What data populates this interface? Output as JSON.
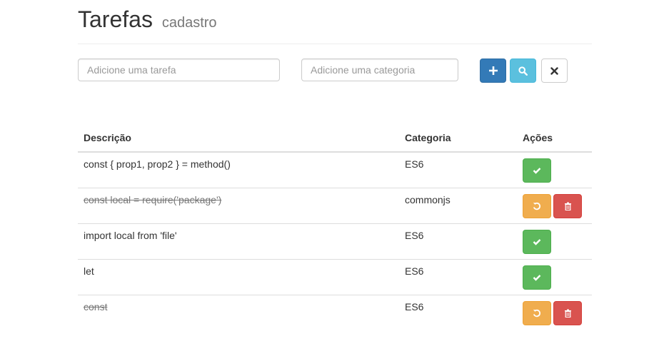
{
  "header": {
    "title": "Tarefas",
    "subtitle": "cadastro"
  },
  "form": {
    "task_placeholder": "Adicione uma tarefa",
    "category_placeholder": "Adicione uma categoria",
    "add_icon": "plus-icon",
    "search_icon": "search-icon",
    "clear_icon": "close-icon"
  },
  "table": {
    "headers": {
      "description": "Descrição",
      "category": "Categoria",
      "actions": "Ações"
    },
    "rows": [
      {
        "description": "const { prop1, prop2 } = method()",
        "category": "ES6",
        "done": false
      },
      {
        "description": "const local = require('package')",
        "category": "commonjs",
        "done": true
      },
      {
        "description": "import local from 'file'",
        "category": "ES6",
        "done": false
      },
      {
        "description": "let",
        "category": "ES6",
        "done": false
      },
      {
        "description": "const",
        "category": "ES6",
        "done": true
      }
    ]
  },
  "colors": {
    "primary": "#337ab7",
    "info": "#5bc0de",
    "success": "#5cb85c",
    "warning": "#f0ad4e",
    "danger": "#d9534f"
  }
}
